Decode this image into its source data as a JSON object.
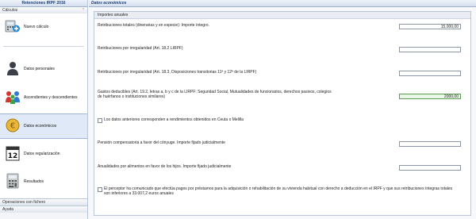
{
  "sidebar": {
    "title": "Retenciones IRPF 2016",
    "section_header": "Cálculos",
    "items": [
      {
        "label": "Nuevo cálculo",
        "icon": "calculator-plus-icon"
      },
      {
        "label": "Datos personales",
        "icon": "person-icon"
      },
      {
        "label": "Ascendientes y descendientes",
        "icon": "family-icon"
      },
      {
        "label": "Datos económicos",
        "icon": "euro-coin-icon"
      },
      {
        "label": "Datos regularización",
        "icon": "calendar-12-icon"
      },
      {
        "label": "Resultados",
        "icon": "calculator-icon"
      }
    ],
    "bottom_sections": [
      "Operaciones con fichero",
      "Ayuda"
    ]
  },
  "main": {
    "title": "Datos económicos",
    "panel_header": "Importes anuales",
    "rows": [
      {
        "label": "Retribuciones totales (dinerarias y en especie): Importe íntegro.",
        "value": "15.000,00"
      },
      {
        "label": "Retribuciones por irregularidad (Art. 18.2 LIRPF)",
        "value": ""
      },
      {
        "label": "Retribuciones por irregularidad (Art. 18.3, Disposiciones transitorias 11ª y 12ª de la LIRPF)",
        "value": ""
      },
      {
        "label": "Gastos deducibles (Art. 19.2, letras a, b y c de la LIRPF: Seguridad Social, Mutualidades de funcionarios, derechos pasivos, colegios de huérfanos o instituciones similares)",
        "value": "2000,00"
      }
    ],
    "checkbox_ceuta": "Los datos anteriores corresponden a rendimientos obtenidos en Ceuta o Melilla",
    "row_conyuge": {
      "label": "Pensión compensatoria a favor del cónyuge. Importe fijado judicialmente",
      "value": ""
    },
    "row_hijos": {
      "label": "Anualidades por alimentos en favor de los hijos. Importe fijado judicialmente",
      "value": ""
    },
    "checkbox_vivienda": "El perceptor ha comunicado que efectúa pagos por préstamos para la adquisición o rehabilitación de su vivienda habitual con derecho a deducción en el IRPF y que sus retribuciones íntegras totales son inferiores a 33.007,2 euros anuales"
  }
}
